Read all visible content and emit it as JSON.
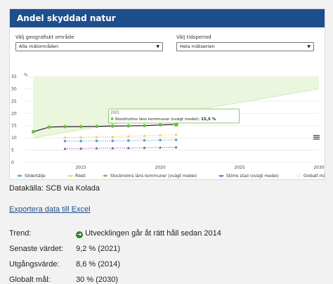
{
  "header": {
    "title": "Andel skyddad natur"
  },
  "filters": {
    "area": {
      "label": "Välj geografiskt område",
      "value": "Alla mätområden"
    },
    "period": {
      "label": "Välj tidsperiod",
      "value": "Hela mätserien"
    }
  },
  "chart_data": {
    "type": "line",
    "ylabel": "%",
    "ylim": [
      0,
      35
    ],
    "yticks": [
      "0",
      "5",
      "10",
      "15",
      "20",
      "25",
      "30",
      "35"
    ],
    "xlim": [
      2011.5,
      2030
    ],
    "xticks": [
      "2015",
      "2020",
      "2025",
      "2030"
    ],
    "x": [
      2012,
      2013,
      2014,
      2015,
      2016,
      2017,
      2018,
      2019,
      2020,
      2021
    ],
    "series": [
      {
        "name": "Södertälje",
        "color": "#4aa3df",
        "values": [
          null,
          null,
          8.7,
          8.7,
          8.8,
          8.8,
          8.9,
          9.0,
          9.1,
          9.2
        ]
      },
      {
        "name": "Riket",
        "color": "#f2c744",
        "values": [
          null,
          null,
          10.2,
          10.3,
          10.4,
          10.5,
          10.7,
          10.9,
          11.1,
          11.3
        ]
      },
      {
        "name": "Stockholms läns kommuner (ovägt medel)",
        "color": "#6abf3a",
        "values": [
          12.5,
          14.4,
          14.6,
          14.6,
          14.7,
          14.8,
          14.9,
          15.0,
          15.3,
          15.5
        ]
      },
      {
        "name": "Större stad (ovägt medel)",
        "color": "#8e44ad",
        "values": [
          null,
          null,
          5.6,
          5.7,
          5.8,
          5.8,
          5.9,
          6.0,
          6.1,
          6.2
        ]
      },
      {
        "name": "Globalt mål",
        "color": "#d8ecc4"
      }
    ],
    "goal_line": {
      "from": [
        2012,
        10
      ],
      "to": [
        2030,
        30
      ]
    },
    "tooltip": {
      "year": "2021",
      "label": "Stockholms läns kommuner (ovägt medel): ",
      "value": "15,5 %"
    }
  },
  "info": {
    "source": "Datakälla: SCB via Kolada",
    "export_link": "Exportera data till Excel",
    "rows": [
      {
        "key": "Trend:",
        "value": "Utvecklingen går åt rätt håll sedan 2014",
        "icon": "arrow-right-circle-icon"
      },
      {
        "key": "Senaste värdet:",
        "value": "9,2 % (2021)"
      },
      {
        "key": "Utgångsvärde:",
        "value": "8,6 % (2014)"
      },
      {
        "key": "Globalt mål:",
        "value": "30 % (2030)"
      }
    ]
  }
}
